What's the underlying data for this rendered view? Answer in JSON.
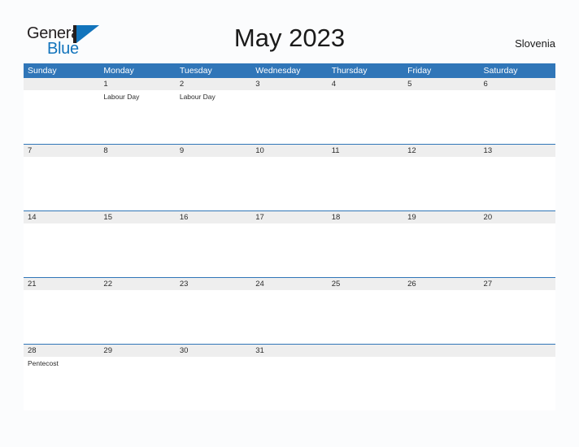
{
  "brand": {
    "word_one": "General",
    "word_two": "Blue",
    "mark": "triangle-logo"
  },
  "header": {
    "title": "May 2023",
    "country": "Slovenia"
  },
  "colors": {
    "header_blue": "#3076b8",
    "brand_blue": "#1274bc",
    "band_gray": "#eeeeee",
    "page_bg": "#fbfcfd",
    "text_dark": "#2b2b2b"
  },
  "calendar": {
    "day_names": [
      "Sunday",
      "Monday",
      "Tuesday",
      "Wednesday",
      "Thursday",
      "Friday",
      "Saturday"
    ],
    "weeks": [
      {
        "days": [
          {
            "num": "",
            "events": []
          },
          {
            "num": "1",
            "events": [
              "Labour Day"
            ]
          },
          {
            "num": "2",
            "events": [
              "Labour Day"
            ]
          },
          {
            "num": "3",
            "events": []
          },
          {
            "num": "4",
            "events": []
          },
          {
            "num": "5",
            "events": []
          },
          {
            "num": "6",
            "events": []
          }
        ]
      },
      {
        "days": [
          {
            "num": "7",
            "events": []
          },
          {
            "num": "8",
            "events": []
          },
          {
            "num": "9",
            "events": []
          },
          {
            "num": "10",
            "events": []
          },
          {
            "num": "11",
            "events": []
          },
          {
            "num": "12",
            "events": []
          },
          {
            "num": "13",
            "events": []
          }
        ]
      },
      {
        "days": [
          {
            "num": "14",
            "events": []
          },
          {
            "num": "15",
            "events": []
          },
          {
            "num": "16",
            "events": []
          },
          {
            "num": "17",
            "events": []
          },
          {
            "num": "18",
            "events": []
          },
          {
            "num": "19",
            "events": []
          },
          {
            "num": "20",
            "events": []
          }
        ]
      },
      {
        "days": [
          {
            "num": "21",
            "events": []
          },
          {
            "num": "22",
            "events": []
          },
          {
            "num": "23",
            "events": []
          },
          {
            "num": "24",
            "events": []
          },
          {
            "num": "25",
            "events": []
          },
          {
            "num": "26",
            "events": []
          },
          {
            "num": "27",
            "events": []
          }
        ]
      },
      {
        "days": [
          {
            "num": "28",
            "events": [
              "Pentecost"
            ]
          },
          {
            "num": "29",
            "events": []
          },
          {
            "num": "30",
            "events": []
          },
          {
            "num": "31",
            "events": []
          },
          {
            "num": "",
            "events": []
          },
          {
            "num": "",
            "events": []
          },
          {
            "num": "",
            "events": []
          }
        ]
      }
    ]
  }
}
